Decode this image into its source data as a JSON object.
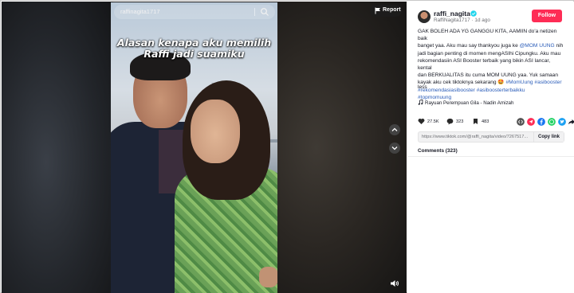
{
  "search": {
    "text": "raffinagita1717"
  },
  "report_label": "Report",
  "video": {
    "caption_line1": "Alasan kenapa aku memilih",
    "caption_line2": "Raffi jadi suamiku"
  },
  "author": {
    "username": "raffi_nagita",
    "handle": "RaffiNagita1717",
    "time": "1d ago"
  },
  "follow_label": "Follow",
  "description": {
    "line1": "GAK BOLEH ADA YG GANGGU KITA, AAMIIN do'a netizen baik",
    "line2": "banget yaa. Aku mau say thankyou juga ke",
    "mention": "@MOM UUNG",
    "line2b": "nih",
    "line3": "jadi bagian penting di momen mengASIhi Cipungku. Aku mau",
    "line4": "rekomendasiin ASI Booster terbaik yang bikin ASI lancar, kental",
    "line5": "dan BERKUALITAS itu cuma MOM UUNG yaa. Yuk samaan",
    "line6": "kayak aku cek tiktoknya sekarang 🤩",
    "tag1": "#MomUung",
    "tag2": "#asibooster",
    "tag3": "#rekomendasiasibooster",
    "tag4": "#asiboosterterbaikku",
    "tag5": "#topmomuung"
  },
  "less_label": "less",
  "music": "Rayuan Perempuan Gila - Nadin Amizah",
  "stats": {
    "likes": "27.5K",
    "comments": "323",
    "saves": "483"
  },
  "share_colors": [
    "#555555",
    "#fe2c55",
    "#1877f2",
    "#25d366",
    "#1da1f2",
    "#161823"
  ],
  "link": {
    "url": "https://www.tiktok.com/@raffi_nagita/video/7267517...",
    "copy_label": "Copy link"
  },
  "comments_label": "Comments (323)"
}
